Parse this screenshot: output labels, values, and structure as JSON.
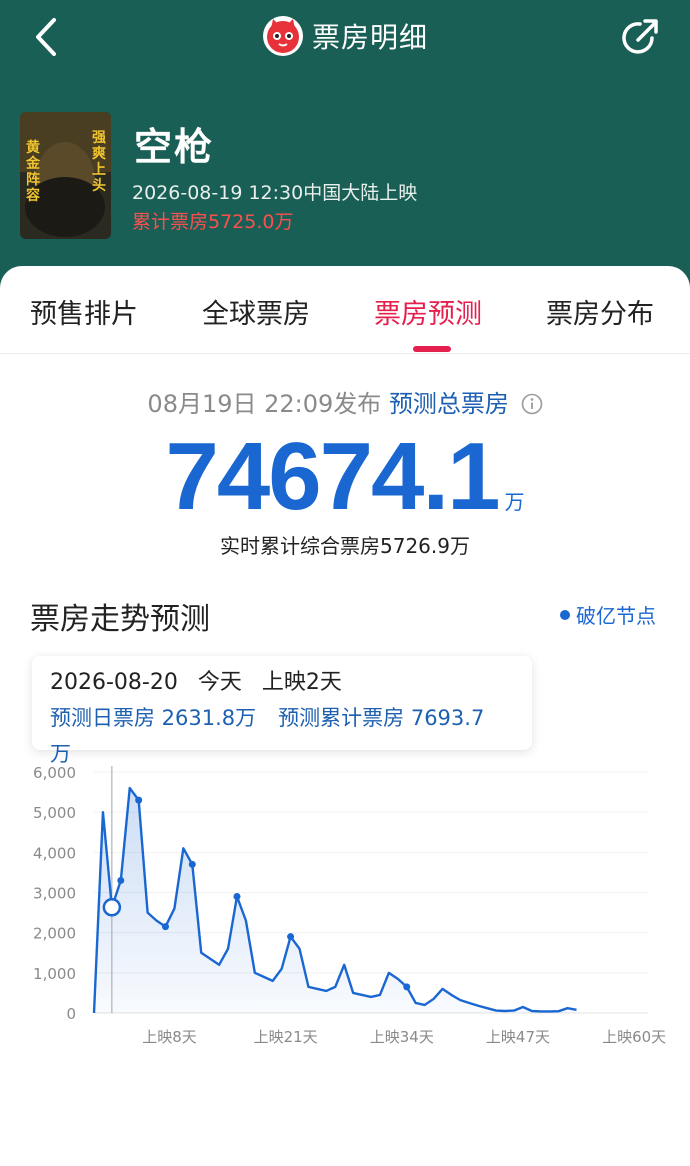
{
  "nav": {
    "title": "票房明细"
  },
  "movie": {
    "title": "空枪",
    "release": "2026-08-19 12:30中国大陆上映",
    "box_office": "累计票房5725.0万",
    "poster_text": [
      "黄",
      "金",
      "阵",
      "容",
      "强",
      "爽",
      "上",
      "头"
    ]
  },
  "tabs": [
    "预售排片",
    "全球票房",
    "票房预测",
    "票房分布"
  ],
  "active_tab": "票房预测",
  "forecast": {
    "published": "08月19日 22:09发布",
    "label": "预测总票房",
    "total": "74674.1",
    "unit": "万",
    "realtime": "实时累计综合票房5726.9万"
  },
  "trend": {
    "title": "票房走势预测",
    "milestone_label": "破亿节点"
  },
  "tooltip": {
    "date": "2026-08-20",
    "today": "今天",
    "day": "上映2天",
    "daily": "预测日票房 2631.8万",
    "cumulative": "预测累计票房 7693.7万"
  },
  "colors": {
    "header": "#195f55",
    "accent": "#e5204e",
    "blue": "#1a67d2"
  },
  "chart_data": {
    "type": "area",
    "ylim": [
      0,
      6000
    ],
    "yticks": [
      "0",
      "1,000",
      "2,000",
      "3,000",
      "4,000",
      "5,000",
      "6,000"
    ],
    "xtick_labels": [
      "上映8天",
      "上映21天",
      "上映34天",
      "上映47天",
      "上映60天"
    ],
    "xtick_days": [
      8,
      21,
      34,
      47,
      60
    ],
    "x": [
      1,
      2,
      3,
      4,
      5,
      6,
      7,
      8,
      9,
      10,
      11,
      12,
      13,
      14,
      15,
      16,
      17,
      18,
      19,
      20,
      21,
      22,
      23,
      24,
      25,
      26,
      27,
      28,
      29,
      30,
      31,
      32,
      33,
      34,
      35,
      36,
      37,
      38,
      39,
      40,
      41,
      42,
      43,
      44,
      45,
      46,
      47,
      48,
      49,
      50,
      51,
      52,
      53,
      54,
      55,
      56,
      57,
      58,
      59,
      60,
      61
    ],
    "values": [
      5000,
      2632,
      3300,
      5600,
      5300,
      2500,
      2300,
      2150,
      2600,
      4100,
      3700,
      1500,
      1350,
      1200,
      1600,
      2900,
      2300,
      1000,
      900,
      800,
      1100,
      1900,
      1600,
      650,
      600,
      550,
      650,
      1200,
      500,
      450,
      400,
      450,
      1000,
      850,
      650,
      250,
      200,
      350,
      600,
      450,
      320,
      250,
      180,
      120,
      60,
      50,
      60,
      150,
      50,
      40,
      40,
      45,
      120,
      80
    ],
    "markers": [
      3,
      5,
      8,
      11,
      16,
      22,
      35
    ],
    "current_day": 2
  }
}
